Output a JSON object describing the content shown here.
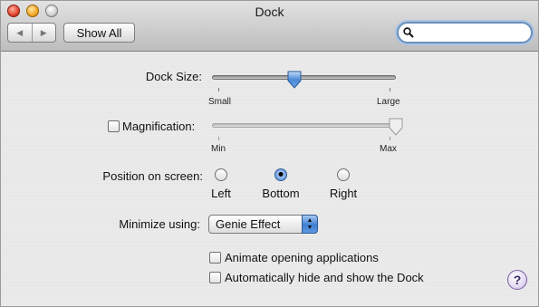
{
  "window": {
    "title": "Dock"
  },
  "toolbar": {
    "back_glyph": "◀",
    "forward_glyph": "▶",
    "show_all_label": "Show All",
    "search_placeholder": ""
  },
  "dock_size": {
    "label": "Dock Size:",
    "min_label": "Small",
    "max_label": "Large",
    "value_percent": 43
  },
  "magnification": {
    "label": "Magnification:",
    "checked": false,
    "min_label": "Min",
    "max_label": "Max",
    "value_percent": 100
  },
  "position": {
    "label": "Position on screen:",
    "options": [
      "Left",
      "Bottom",
      "Right"
    ],
    "selected": "Bottom"
  },
  "minimize": {
    "label": "Minimize using:",
    "value": "Genie Effect"
  },
  "options": {
    "animate_label": "Animate opening applications",
    "animate_checked": false,
    "autohide_label": "Automatically hide and show the Dock",
    "autohide_checked": false
  },
  "help": {
    "glyph": "?"
  },
  "colors": {
    "accent": "#3f7fd1",
    "search_ring": "#a9c4e6"
  }
}
